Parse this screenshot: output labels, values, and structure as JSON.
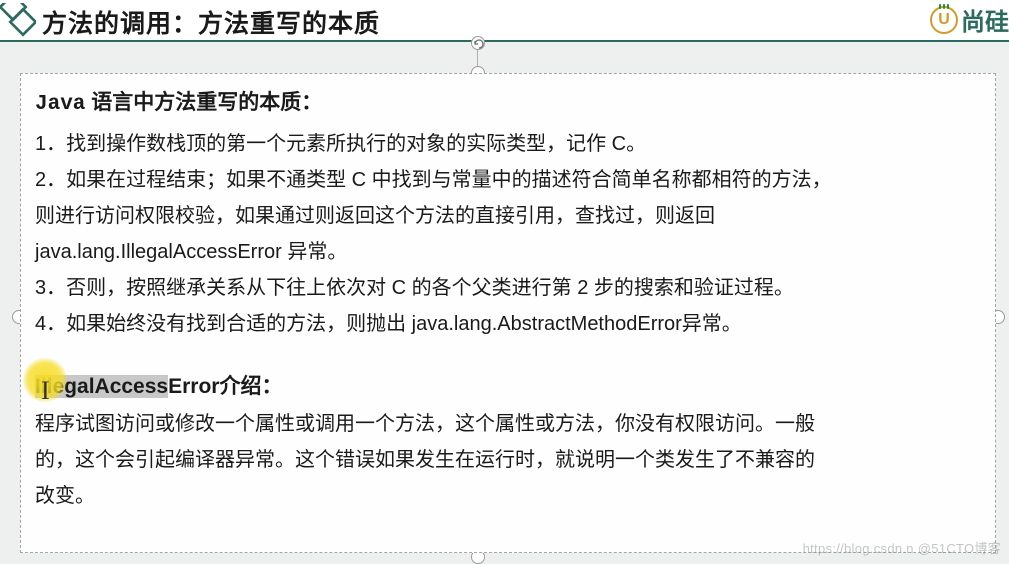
{
  "header": {
    "title": "方法的调用：方法重写的本质",
    "logo_letter": "U",
    "logo_text": "尚硅"
  },
  "section1": {
    "title_prefix": "Java",
    "title_rest": " 语言中方法重写的本质：",
    "item1": "1．找到操作数栈顶的第一个元素所执行的对象的实际类型，记作 C。",
    "item2a": "2．如果在过程结束；如果不通类型 C 中找到与常量中的描述符合简单名称都相符的方法，",
    "item2b": "则进行访问权限校验，如果通过则返回这个方法的直接引用，查找过，则返回",
    "item2c": "java.lang.IllegalAccessError 异常。",
    "item3": "3．否则，按照继承关系从下往上依次对 C 的各个父类进行第 2 步的搜索和验证过程。",
    "item4": "4．如果始终没有找到合适的方法，则抛出 java.lang.AbstractMethodError异常。"
  },
  "section2": {
    "title_highlight": "IllegalAccess",
    "title_rest": "Error介绍：",
    "body1": "程序试图访问或修改一个属性或调用一个方法，这个属性或方法，你没有权限访问。一般",
    "body2": "的，这个会引起编译器异常。这个错误如果发生在运行时，就说明一个类发生了不兼容的",
    "body3": "改变。"
  },
  "watermark": "https://blog.csdn.n  @51CTO博客"
}
